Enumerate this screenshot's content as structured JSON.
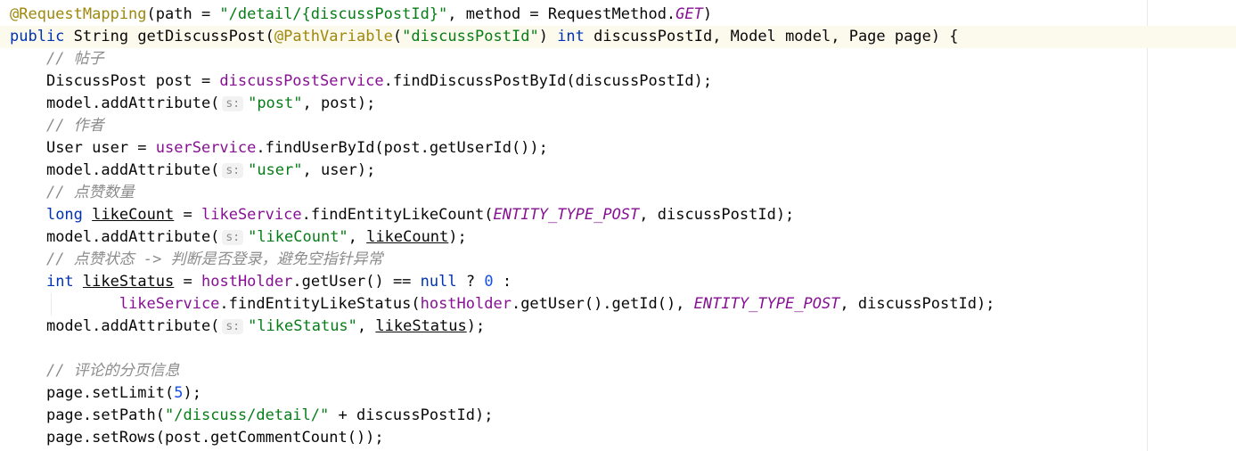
{
  "editor": {
    "line_1": {
      "annotation": "@RequestMapping",
      "t1": "(path = ",
      "s1": "\"/detail/{discussPostId}\"",
      "t2": ", method = RequestMethod.",
      "c1": "GET",
      "t3": ")"
    },
    "line_2": {
      "k1": "public",
      "t1": " String ",
      "method_name": "getDiscussPost",
      "t2": "(",
      "annotation": "@PathVariable",
      "t3": "(",
      "s1": "\"discussPostId\"",
      "t4": ") ",
      "k2": "int",
      "t5": " discussPostId, Model model, Page page) {"
    },
    "line_3": {
      "comment": "// 帖子"
    },
    "line_4": {
      "t1": "DiscussPost post = ",
      "f1": "discussPostService",
      "t2": ".findDiscussPostById(discussPostId);"
    },
    "line_5": {
      "t1": "model.addAttribute(",
      "hint": "s:",
      "s1": "\"post\"",
      "t2": ", post);"
    },
    "line_6": {
      "comment": "// 作者"
    },
    "line_7": {
      "t1": "User user = ",
      "f1": "userService",
      "t2": ".findUserById(post.getUserId());"
    },
    "line_8": {
      "t1": "model.addAttribute(",
      "hint": "s:",
      "s1": "\"user\"",
      "t2": ", user);"
    },
    "line_9": {
      "comment": "// 点赞数量"
    },
    "line_10": {
      "k1": "long",
      "t1": " ",
      "u1": "likeCount",
      "t2": " = ",
      "f1": "likeService",
      "t3": ".findEntityLikeCount(",
      "c1": "ENTITY_TYPE_POST",
      "t4": ", discussPostId);"
    },
    "line_11": {
      "t1": "model.addAttribute(",
      "hint": "s:",
      "s1": "\"likeCount\"",
      "t2": ", ",
      "u1": "likeCount",
      "t3": ");"
    },
    "line_12": {
      "comment": "// 点赞状态 -> 判断是否登录，避免空指针异常"
    },
    "line_13": {
      "k1": "int",
      "t1": " ",
      "u1": "likeStatus",
      "t2": " = ",
      "f1": "hostHolder",
      "t3": ".getUser() == ",
      "k2": "null",
      "t4": " ? ",
      "n1": "0",
      "t5": " :"
    },
    "line_14": {
      "f1": "likeService",
      "t1": ".findEntityLikeStatus(",
      "f2": "hostHolder",
      "t2": ".getUser().getId(), ",
      "c1": "ENTITY_TYPE_POST",
      "t3": ", discussPostId);"
    },
    "line_15": {
      "t1": "model.addAttribute(",
      "hint": "s:",
      "s1": "\"likeStatus\"",
      "t2": ", ",
      "u1": "likeStatus",
      "t3": ");"
    },
    "line_16": {},
    "line_17": {
      "comment": "// 评论的分页信息"
    },
    "line_18": {
      "t1": "page.setLimit(",
      "n1": "5",
      "t2": ");"
    },
    "line_19": {
      "t1": "page.setPath(",
      "s1": "\"/discuss/detail/\"",
      "t2": " + discussPostId);"
    },
    "line_20": {
      "t1": "page.setRows(post.getCommentCount());"
    }
  },
  "colors": {
    "annotation": "#9e880d",
    "keyword": "#0033b3",
    "string": "#067d17",
    "number": "#1750eb",
    "comment": "#8c8c8c",
    "field": "#871094",
    "default_text": "#080808",
    "current_line_bg": "#fcfaed"
  }
}
